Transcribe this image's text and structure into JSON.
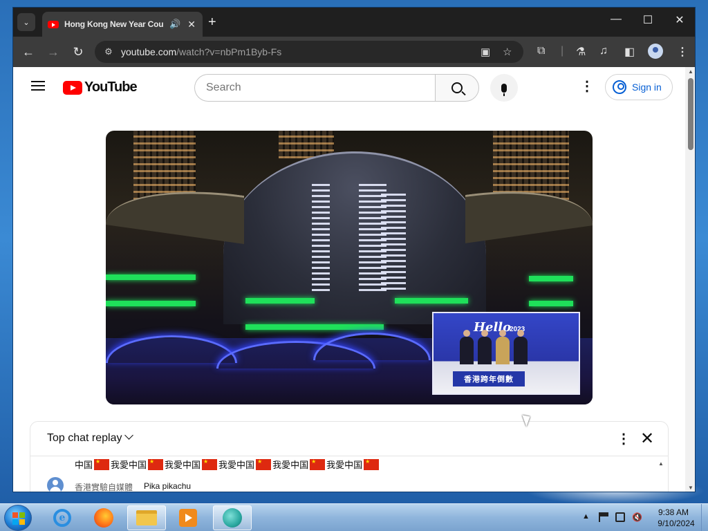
{
  "browser": {
    "tab_title": "Hong Kong New Year Cou",
    "new_tab": "+",
    "url_host": "youtube.com",
    "url_path": "/watch?v=nbPm1Byb-Fs",
    "window_controls": {
      "minimize": "—",
      "maximize": "☐",
      "close": "✕"
    },
    "icons": [
      "back-arrow-icon",
      "forward-arrow-icon",
      "reload-icon",
      "site-info-icon",
      "cast-icon",
      "star-icon",
      "extensions-icon",
      "labs-icon",
      "media-control-icon",
      "side-panel-icon",
      "profile-icon",
      "menu-icon"
    ]
  },
  "youtube": {
    "logo_text": "YouTube",
    "search_placeholder": "Search",
    "sign_in": "Sign in",
    "accent": "#ff0000",
    "link_color": "#065fd4"
  },
  "video": {
    "pip_hello": "Hello",
    "pip_year": "2023",
    "pip_banner": "香港跨年倒數"
  },
  "chat": {
    "title": "Top chat replay",
    "line1_segments": [
      "中国",
      "我愛中国",
      "我愛中国",
      "我愛中国",
      "我愛中国",
      "我愛中国",
      ""
    ],
    "author": "香港實驗自媒體",
    "message": "Pika pikachu"
  },
  "taskbar": {
    "apps": [
      "internet-explorer",
      "firefox",
      "file-explorer",
      "media-player",
      "browser-app"
    ],
    "time": "9:38 AM",
    "date": "9/10/2024",
    "tray_arrow": "▲"
  }
}
